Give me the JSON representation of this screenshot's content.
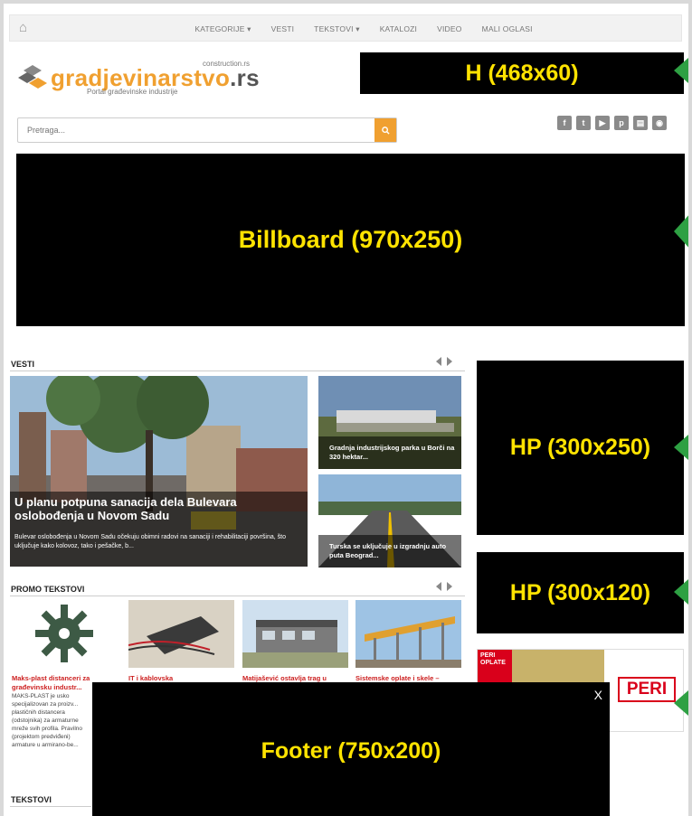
{
  "nav": {
    "home_icon": "home-icon",
    "items": [
      "KATEGORIJE",
      "VESTI",
      "TEKSTOVI",
      "KATALOZI",
      "VIDEO",
      "MALI OGLASI"
    ],
    "dropdown_markers": [
      "KATEGORIJE",
      "TEKSTOVI"
    ]
  },
  "logo": {
    "domain": "construction.rs",
    "name_main": "gradjevinarstvo",
    "name_ext": ".rs",
    "tagline": "Portal građevinske industrije"
  },
  "search": {
    "placeholder": "Pretraga...",
    "button_icon": "search-icon"
  },
  "social_icons": [
    "facebook-icon",
    "twitter-icon",
    "youtube-icon",
    "pinterest-icon",
    "catalog-icon",
    "rss-icon"
  ],
  "ads": {
    "header": "H (468x60)",
    "billboard": "Billboard (970x250)",
    "hp_large": "HP (300x250)",
    "hp_small": "HP (300x120)",
    "footer": "Footer (750x200)",
    "footer_close": "X"
  },
  "vesti": {
    "title": "VESTI",
    "hero_title": "U planu potpuna sanacija dela Bulevara oslobođenja u Novom Sadu",
    "hero_desc": "Bulevar oslobođenja u Novom Sadu očekuju obimni radovi na sanaciji i rehabilitaciji površina, što uključuje kako kolovoz, tako i pešačke, b...",
    "side": [
      {
        "title": "Gradnja industrijskog parka u Borči na 320 hektar..."
      },
      {
        "title": "Turska se uključuje u izgradnju auto puta Beograd..."
      }
    ]
  },
  "promo": {
    "title": "PROMO TEKSTOVI",
    "items": [
      {
        "title": "Maks-plast distanceri za građevinsku industr...",
        "desc": "MAKS-PLAST je usko specijalizovan za proizv... plastičnih distancera (odstojnika) za armaturne mreže svih profila. Pravilno (projektom predviđeni) armature u armirano-be..."
      },
      {
        "title": "IT i kablovska"
      },
      {
        "title": "Matijašević ostavlja trag u"
      },
      {
        "title": "Sistemske oplate i skele –"
      }
    ]
  },
  "peri": {
    "badge": "PERI OPLATE",
    "logo": "PERI"
  },
  "tekstovi": {
    "title": "TEKSTOVI"
  }
}
